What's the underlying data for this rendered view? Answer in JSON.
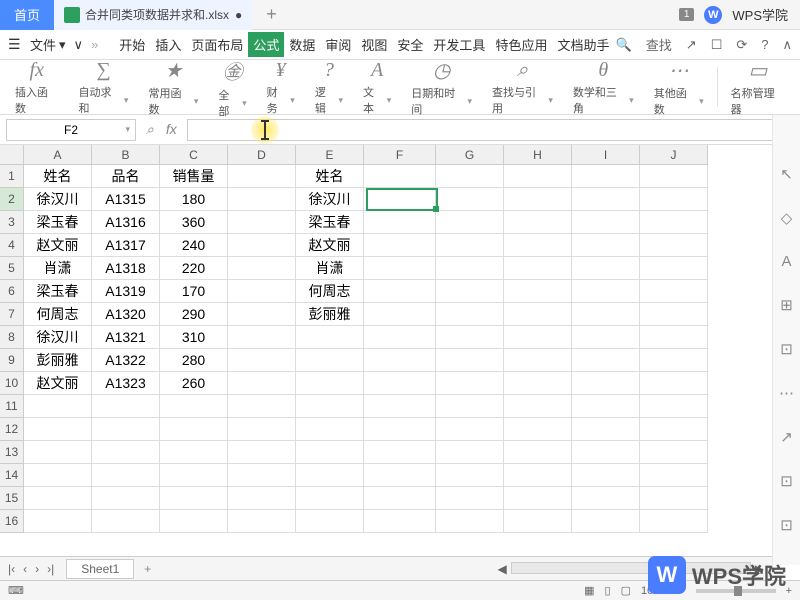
{
  "title_bar": {
    "home_tab": "首页",
    "file_name": "合并同类项数据并求和.xlsx",
    "plus": "+",
    "badge": "1",
    "wps_logo": "W",
    "wps_text": "WPS学院"
  },
  "menu": {
    "file": "文件",
    "sep": "»",
    "tabs": [
      "开始",
      "插入",
      "页面布局",
      "公式",
      "数据",
      "审阅",
      "视图",
      "安全",
      "开发工具",
      "特色应用",
      "文档助手"
    ],
    "active_tab": 3,
    "search": "查找",
    "icons": [
      "↗",
      "☐",
      "⟳",
      "?",
      "∧"
    ]
  },
  "ribbon": [
    {
      "icon": "fx",
      "label": "插入函数",
      "dd": false
    },
    {
      "icon": "∑",
      "label": "自动求和",
      "dd": true
    },
    {
      "icon": "★",
      "label": "常用函数",
      "dd": true
    },
    {
      "icon": "㊎",
      "label": "全部",
      "dd": true
    },
    {
      "icon": "¥",
      "label": "财务",
      "dd": true
    },
    {
      "icon": "?",
      "label": "逻辑",
      "dd": true
    },
    {
      "icon": "A",
      "label": "文本",
      "dd": true
    },
    {
      "icon": "◷",
      "label": "日期和时间",
      "dd": true
    },
    {
      "icon": "⌕",
      "label": "查找与引用",
      "dd": true
    },
    {
      "icon": "θ",
      "label": "数学和三角",
      "dd": true
    },
    {
      "icon": "⋯",
      "label": "其他函数",
      "dd": true
    },
    {
      "icon": "▭",
      "label": "名称管理器",
      "dd": false
    }
  ],
  "formula": {
    "name_box": "F2",
    "fx": "fx",
    "zoom_icon": "⌕"
  },
  "columns": [
    "A",
    "B",
    "C",
    "D",
    "E",
    "F",
    "G",
    "H",
    "I",
    "J"
  ],
  "rows": [
    1,
    2,
    3,
    4,
    5,
    6,
    7,
    8,
    9,
    10,
    11,
    12,
    13,
    14,
    15,
    16
  ],
  "selected_row": 2,
  "data": {
    "A": [
      "姓名",
      "徐汉川",
      "梁玉春",
      "赵文丽",
      "肖潇",
      "梁玉春",
      "何周志",
      "徐汉川",
      "彭丽雅",
      "赵文丽"
    ],
    "B": [
      "品名",
      "A1315",
      "A1316",
      "A1317",
      "A1318",
      "A1319",
      "A1320",
      "A1321",
      "A1322",
      "A1323"
    ],
    "C": [
      "销售量",
      "180",
      "360",
      "240",
      "220",
      "170",
      "290",
      "310",
      "280",
      "260"
    ],
    "E": [
      "姓名",
      "徐汉川",
      "梁玉春",
      "赵文丽",
      "肖潇",
      "何周志",
      "彭丽雅"
    ]
  },
  "sheet": {
    "nav": [
      "|‹",
      "‹",
      "›",
      "›|"
    ],
    "tab": "Sheet1",
    "plus": "+"
  },
  "status": {
    "left": "⌨",
    "view_icons": [
      "▦",
      "▯",
      "▢"
    ],
    "zoom": "100%",
    "minus": "−",
    "plus": "+"
  },
  "side_icons": [
    "↖",
    "◇",
    "A",
    "⊞",
    "⊡",
    "⋯",
    "↗",
    "⊡",
    "⊡"
  ],
  "scroll_icon": "▲",
  "watermark": {
    "logo": "W",
    "text": "WPS学院"
  }
}
